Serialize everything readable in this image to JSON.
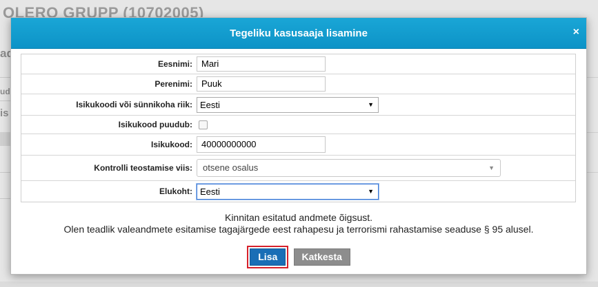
{
  "background": {
    "title": "OLERO GRUPP (10702005)",
    "stubs": [
      "ad",
      "ud",
      "is"
    ]
  },
  "modal": {
    "title": "Tegeliku kasusaaja lisamine",
    "close": "×"
  },
  "form": {
    "first_name": {
      "label": "Eesnimi:",
      "value": "Mari"
    },
    "last_name": {
      "label": "Perenimi:",
      "value": "Puuk"
    },
    "id_country": {
      "label": "Isikukoodi või sünnikoha riik:",
      "value": "Eesti"
    },
    "id_missing": {
      "label": "Isikukood puudub:",
      "checked": false
    },
    "id_code": {
      "label": "Isikukood:",
      "value": "40000000000"
    },
    "control_method": {
      "label": "Kontrolli teostamise viis:",
      "value": "otsene osalus"
    },
    "residence": {
      "label": "Elukoht:",
      "value": "Eesti"
    }
  },
  "notice": {
    "line1": "Kinnitan esitatud andmete õigsust.",
    "line2": "Olen teadlik valeandmete esitamise tagajärgede eest rahapesu ja terrorismi rahastamise seaduse § 95 alusel."
  },
  "buttons": {
    "add": "Lisa",
    "cancel": "Katkesta"
  },
  "icons": {
    "dropdown": "▼",
    "close": "close-icon"
  },
  "colors": {
    "header": "#0d93c7",
    "primary": "#1a6eb6",
    "highlight": "#d6202a"
  }
}
